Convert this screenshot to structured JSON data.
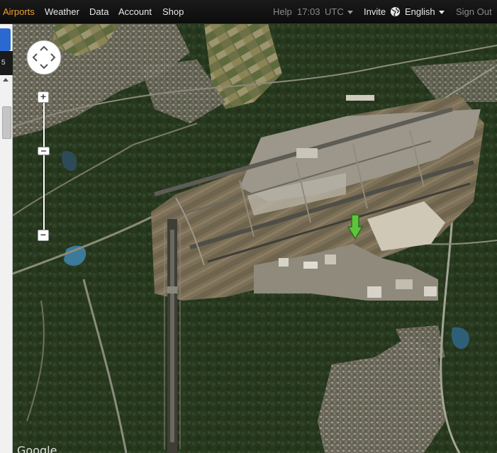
{
  "nav": {
    "items": [
      "Airports",
      "Weather",
      "Data",
      "Account",
      "Shop"
    ],
    "active": "Airports",
    "help": "Help",
    "time": "17:03",
    "timezone": "UTC",
    "invite": "Invite",
    "language": "English",
    "sign_out": "Sign Out"
  },
  "sidebar": {
    "badge": "5"
  },
  "map": {
    "attribution": "Google",
    "marker_color": "#5ec43a",
    "accent_color": "#f0a030"
  },
  "icons": {
    "pan": "pan-control-icon",
    "zoom_in": "zoom-in-icon",
    "zoom_out": "zoom-out-icon",
    "language": "globe-icon",
    "marker": "down-arrow-marker-icon"
  }
}
